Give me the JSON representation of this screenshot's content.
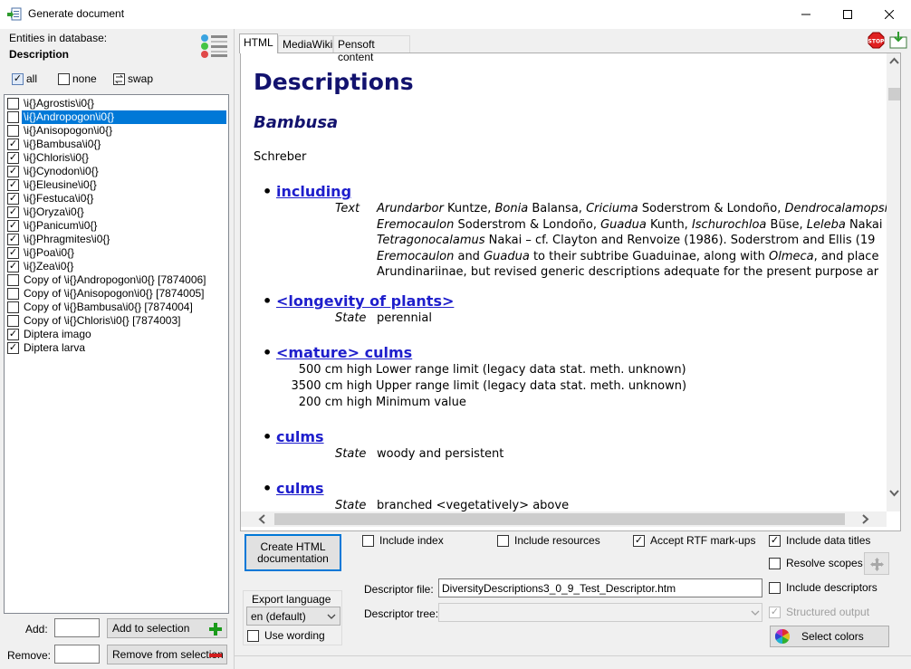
{
  "window": {
    "title": "Generate document",
    "icon": "generate-document-icon",
    "controls": [
      "minimize-icon",
      "maximize-icon",
      "close-icon"
    ]
  },
  "left_panel": {
    "entities_label": "Entities in database:",
    "entity_type": "Description",
    "all_label": "all",
    "all_checked": true,
    "none_label": "none",
    "swap_label": "swap",
    "items": [
      {
        "label": "\\i{}Agrostis\\i0{}",
        "checked": false,
        "selected": false
      },
      {
        "label": "\\i{}Andropogon\\i0{}",
        "checked": false,
        "selected": true
      },
      {
        "label": "\\i{}Anisopogon\\i0{}",
        "checked": false,
        "selected": false
      },
      {
        "label": "\\i{}Bambusa\\i0{}",
        "checked": true,
        "selected": false
      },
      {
        "label": "\\i{}Chloris\\i0{}",
        "checked": true,
        "selected": false
      },
      {
        "label": "\\i{}Cynodon\\i0{}",
        "checked": true,
        "selected": false
      },
      {
        "label": "\\i{}Eleusine\\i0{}",
        "checked": true,
        "selected": false
      },
      {
        "label": "\\i{}Festuca\\i0{}",
        "checked": true,
        "selected": false
      },
      {
        "label": "\\i{}Oryza\\i0{}",
        "checked": true,
        "selected": false
      },
      {
        "label": "\\i{}Panicum\\i0{}",
        "checked": true,
        "selected": false
      },
      {
        "label": "\\i{}Phragmites\\i0{}",
        "checked": true,
        "selected": false
      },
      {
        "label": "\\i{}Poa\\i0{}",
        "checked": true,
        "selected": false
      },
      {
        "label": "\\i{}Zea\\i0{}",
        "checked": true,
        "selected": false
      },
      {
        "label": "Copy of  \\i{}Andropogon\\i0{} [7874006]",
        "checked": false,
        "selected": false
      },
      {
        "label": "Copy of  \\i{}Anisopogon\\i0{} [7874005]",
        "checked": false,
        "selected": false
      },
      {
        "label": "Copy of  \\i{}Bambusa\\i0{} [7874004]",
        "checked": false,
        "selected": false
      },
      {
        "label": "Copy of  \\i{}Chloris\\i0{} [7874003]",
        "checked": false,
        "selected": false
      },
      {
        "label": "Diptera imago",
        "checked": true,
        "selected": false
      },
      {
        "label": "Diptera larva",
        "checked": true,
        "selected": false
      }
    ],
    "add_label": "Add:",
    "add_value": "",
    "add_button": "Add to selection",
    "remove_label": "Remove:",
    "remove_value": "",
    "remove_button": "Remove from selection"
  },
  "tabs": [
    {
      "label": "HTML",
      "active": true
    },
    {
      "label": "MediaWiki",
      "active": false
    },
    {
      "label": "Pensoft content",
      "active": false
    }
  ],
  "toolbar_icons": [
    "stop-icon",
    "export-icon"
  ],
  "document": {
    "title": "Descriptions",
    "taxon": "Bambusa",
    "author": "Schreber",
    "sections": [
      {
        "heading": "including",
        "label": "Text",
        "lines": [
          "<i>Arundarbor</i> Kuntze, <i>Bonia</i> Balansa, <i>Criciuma</i> Soderstrom &amp; Londoño, <i>Dendrocalamopsi</i>",
          "<i>Eremocaulon</i> Soderstrom &amp; Londoño, <i>Guadua</i> Kunth, <i>Ischurochloa</i> Büse, <i>Leleba</i> Nakai",
          "<i>Tetragonocalamus</i> Nakai – cf. Clayton and Renvoize (1986). Soderstrom and Ellis (19",
          "<i>Eremocaulon</i> and <i>Guadua</i> to their subtribe Guaduinae, along with <i>Olmeca</i>, and place",
          "Arundinariinae, but revised generic descriptions adequate for the present purpose ar"
        ]
      },
      {
        "heading": "<longevity of plants>",
        "label": "State",
        "value": "perennial"
      },
      {
        "heading": "<mature> culms",
        "measures": [
          {
            "amount": "500 cm high",
            "desc": "Lower range limit (legacy data stat. meth. unknown)"
          },
          {
            "amount": "3500 cm high",
            "desc": "Upper range limit (legacy data stat. meth. unknown)"
          },
          {
            "amount": "200 cm high",
            "desc": "Minimum value"
          }
        ]
      },
      {
        "heading": "culms",
        "label": "State",
        "value": "woody and persistent"
      },
      {
        "heading": "culms",
        "label": "State",
        "value": "branched <vegetatively> above"
      }
    ]
  },
  "options": {
    "create_button": "Create HTML\ndocumentation",
    "include_index": {
      "label": "Include index",
      "checked": false
    },
    "include_resources": {
      "label": "Include resources",
      "checked": false
    },
    "accept_rtf": {
      "label": "Accept RTF mark-ups",
      "checked": true
    },
    "include_data_titles": {
      "label": "Include data titles",
      "checked": true
    },
    "resolve_scopes": {
      "label": "Resolve scopes",
      "checked": false
    },
    "include_descriptors": {
      "label": "Include descriptors",
      "checked": false
    },
    "structured_output": {
      "label": "Structured output",
      "checked": true,
      "disabled": true
    },
    "export_language_label": "Export language",
    "export_language_value": "en (default)",
    "use_wording": {
      "label": "Use wording",
      "checked": false
    },
    "descriptor_file_label": "Descriptor file:",
    "descriptor_file_value": "DiversityDescriptions3_0_9_Test_Descriptor.htm",
    "descriptor_tree_label": "Descriptor tree:",
    "descriptor_tree_value": "",
    "select_colors_button": "Select colors"
  },
  "colors": {
    "selection": "#0078d7",
    "heading": "#12126e",
    "link": "#1e1ecc",
    "add_icon": "#1a9a1a",
    "remove_icon": "#d21e1e"
  }
}
